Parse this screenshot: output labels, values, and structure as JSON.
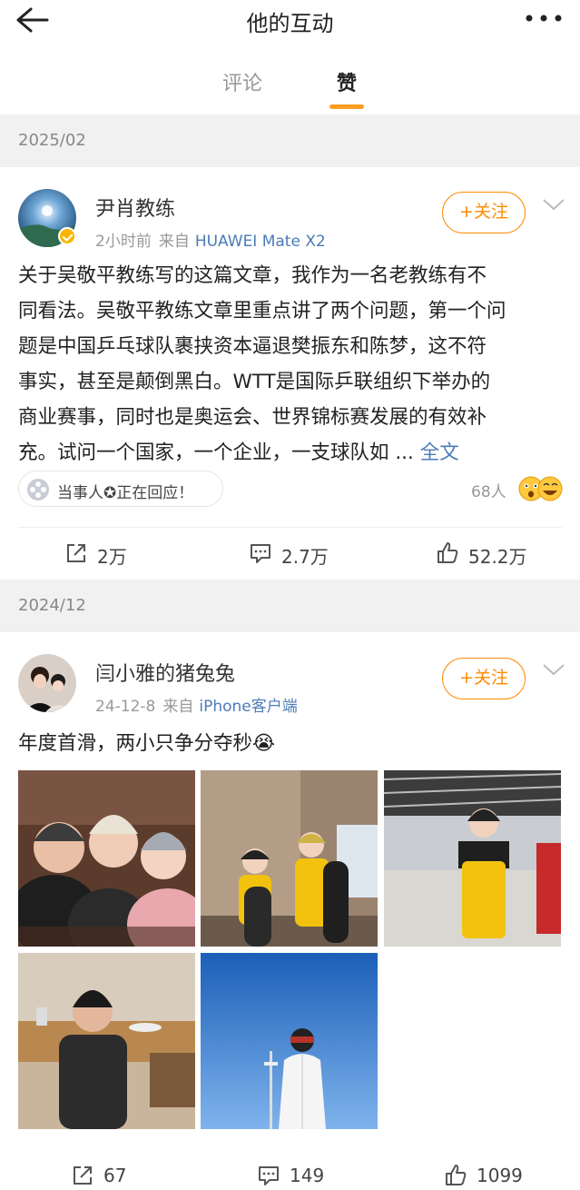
{
  "header": {
    "title": "他的互动",
    "back_icon": "back-arrow-icon",
    "more_icon": "more-dots-icon"
  },
  "tabs": [
    {
      "label": "评论",
      "active": false
    },
    {
      "label": "赞",
      "active": true
    }
  ],
  "accent_color": "#ff8a00",
  "link_color": "#4b7bb8",
  "sections": [
    {
      "date": "2025/02",
      "post": {
        "user": "尹肖教练",
        "verified": true,
        "time": "2小时前",
        "source_prefix": "来自",
        "source": "HUAWEI Mate X2",
        "follow_label": "+关注",
        "text_lines": [
          "关于吴敬平教练写的这篇文章，我作为一名老教练有不",
          "同看法。吴敬平教练文章里重点讲了两个问题，第一个问",
          "题是中国乒乓球队裹挟资本逼退樊振东和陈梦，这不符",
          "事实，甚至是颠倒黑白。WTT是国际乒联组织下举办的",
          "商业赛事，同时也是奥运会、世界锦标赛发展的有效补",
          "充。试问一个国家，一个企业，一支球队如 ..."
        ],
        "full_text_label": "全文",
        "notice": "当事人✪正在回应！",
        "people_count": "68人",
        "actions": {
          "repost": "2万",
          "comment": "2.7万",
          "like": "52.2万"
        }
      }
    },
    {
      "date": "2024/12",
      "post": {
        "user": "闫小雅的猪兔兔",
        "verified": false,
        "time": "24-12-8",
        "source_prefix": "来自",
        "source": "iPhone客户端",
        "follow_label": "+关注",
        "text": "年度首滑，两小只争分夺秒😭",
        "photos": [
          "family-selfie",
          "kids-with-snowboards",
          "kid-in-ski-hall",
          "boy-at-restaurant",
          "skier-blue-sky"
        ],
        "actions": {
          "repost": "67",
          "comment": "149",
          "like": "1099"
        }
      }
    }
  ]
}
